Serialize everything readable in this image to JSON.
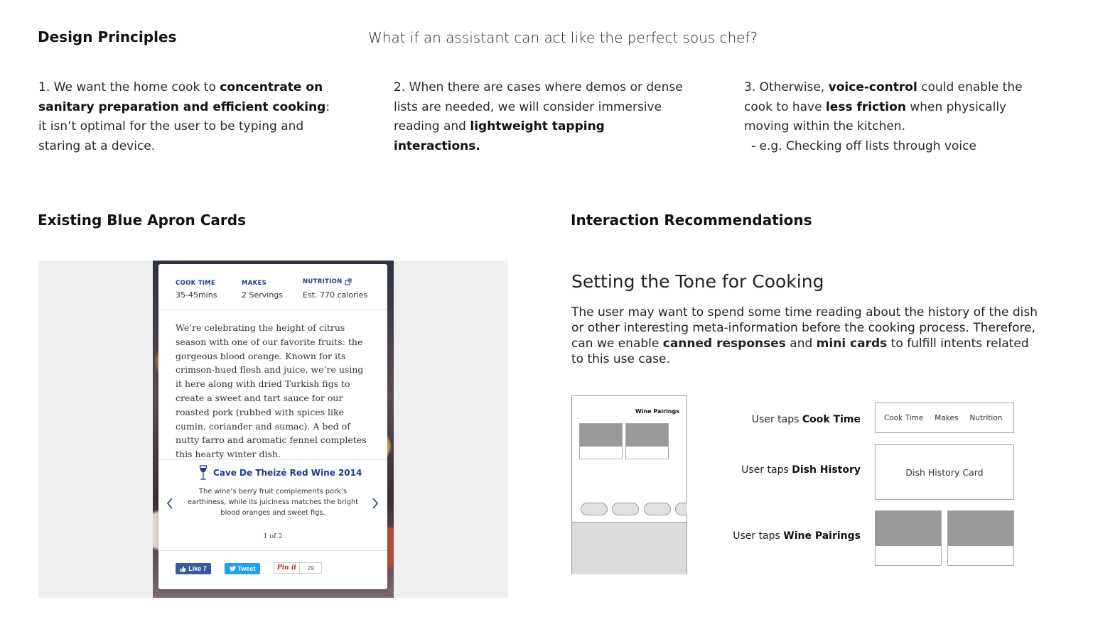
{
  "header": {
    "title": "Design Principles",
    "question": "What if an assistant can act like the perfect sous chef?"
  },
  "principles": [
    {
      "num": "1.",
      "t1": "We want the home cook to ",
      "b1": "concentrate on sanitary preparation and efficient cooking",
      "t2": ": it isn’t optimal for the user to be typing and staring at a device."
    },
    {
      "num": "2.",
      "t1": "When there are cases where demos or dense lists are needed, we will consider immersive reading and ",
      "b1": "lightweight tapping interactions."
    },
    {
      "num": "3.",
      "t1": "Otherwise, ",
      "b1": "voice-control",
      "t2": " could enable the cook to have ",
      "b2": "less friction",
      "t3": " when physically moving within the kitchen.",
      "example": "- e.g. Checking off lists through voice"
    }
  ],
  "existing": {
    "title": "Existing Blue Apron Cards",
    "card": {
      "cook_time_label": "COOK TIME",
      "cook_time": "35-45mins",
      "makes_label": "MAKES",
      "makes": "2 Servings",
      "nutrition_label": "NUTRITION",
      "nutrition": "Est. 770 calories",
      "description": "We’re celebrating the height of citrus season with one of our favorite fruits: the gorgeous blood orange. Known for its crimson-hued flesh and juice, we’re using it here along with dried Turkish figs to create a sweet and tart sauce for our roasted pork (rubbed with spices like cumin, coriander and sumac). A bed of nutty farro and aromatic fennel completes this hearty winter dish.",
      "wine_name": "Cave De Theizé Red Wine 2014",
      "wine_desc": "The wine’s berry fruit complements pork’s earthiness, while its juiciness matches the bright blood oranges and sweet figs.",
      "pager": "1 of 2",
      "like_label": "Like 7",
      "tweet_label": "Tweet",
      "pin_label": "Pin it",
      "pin_count": "29"
    }
  },
  "interaction": {
    "title": "Interaction Recommendations",
    "tone_title": "Setting the Tone for Cooking",
    "tone_body_1": "The user may want to spend some time reading about the history of the dish or other interesting meta-information before the cooking process. Therefore, can we enable ",
    "tone_bold_1": "canned responses",
    "tone_body_2": " and ",
    "tone_bold_2": "mini cards",
    "tone_body_3": " to fulfill intents related to this use case.",
    "wireframe": {
      "header": "Wine Pairings"
    },
    "rows": [
      {
        "prefix": "User taps ",
        "target": "Cook Time"
      },
      {
        "prefix": "User taps ",
        "target": "Dish History"
      },
      {
        "prefix": "User taps ",
        "target": "Wine Pairings"
      }
    ],
    "cook_card": {
      "a": "Cook Time",
      "b": "Makes",
      "c": "Nutrition"
    },
    "history_card": "Dish History Card"
  },
  "colors": {
    "navy": "#1e3a8a",
    "facebook": "#3b5998",
    "twitter": "#1da1f2",
    "pinterest": "#cb2027"
  }
}
